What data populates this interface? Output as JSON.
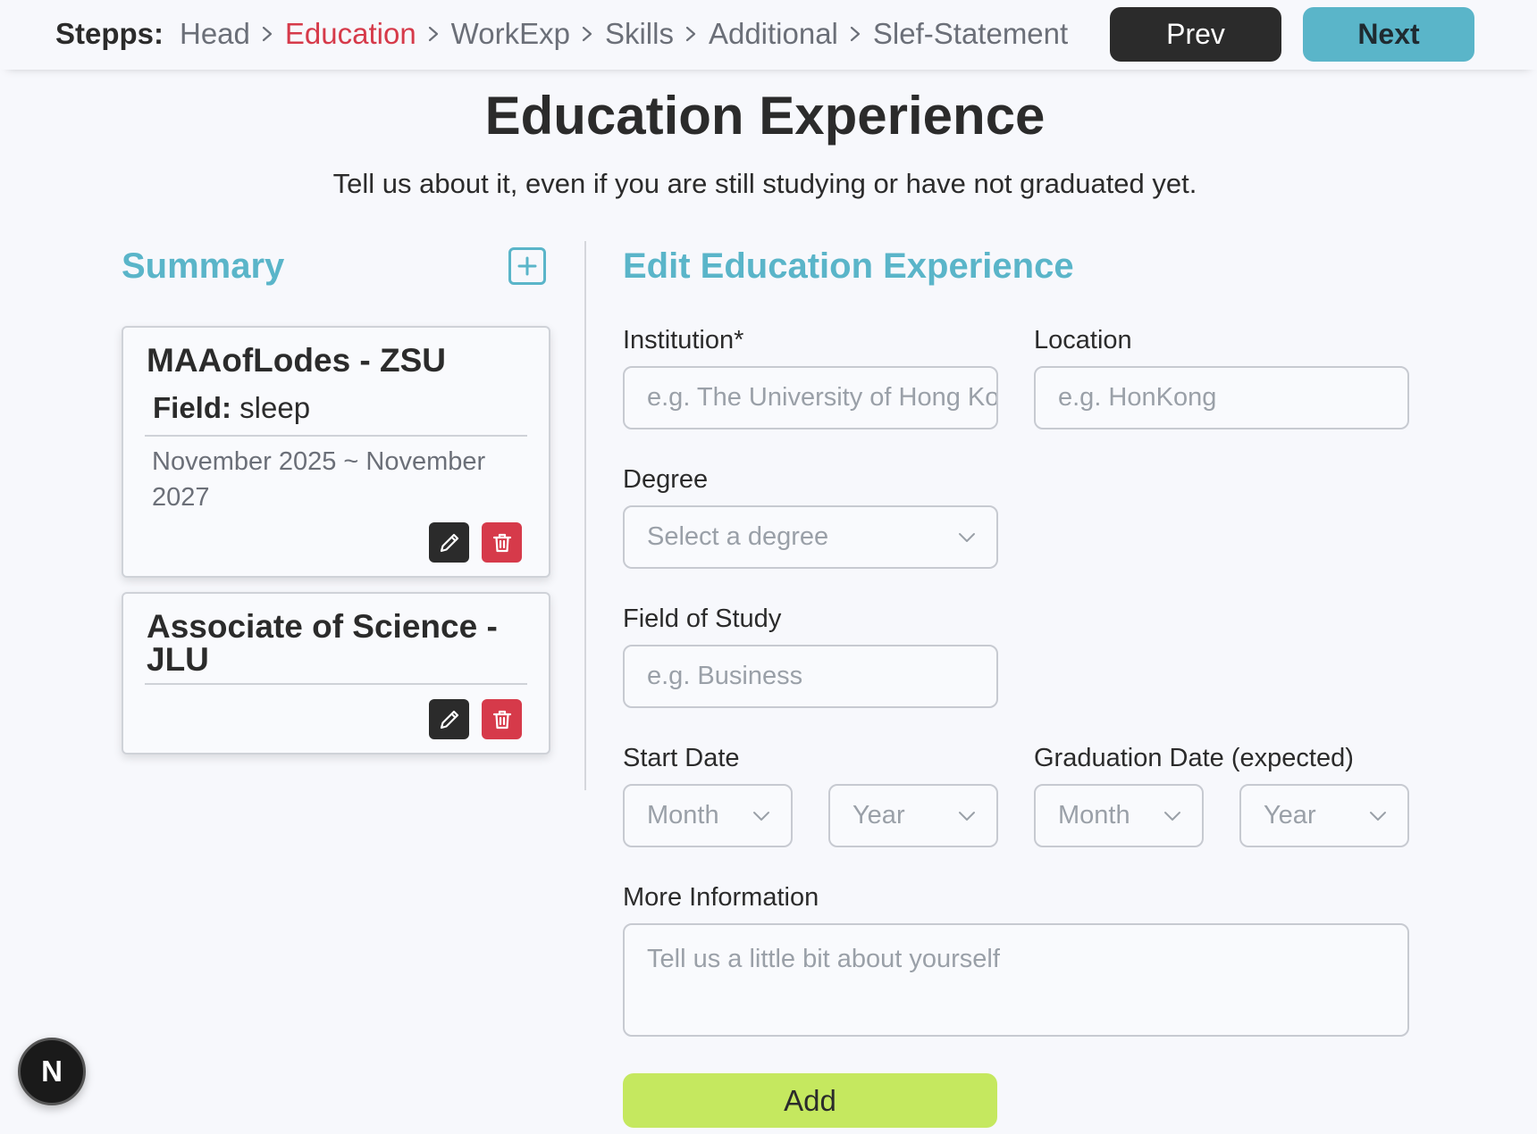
{
  "stepbar": {
    "label": "Stepps:",
    "steps": [
      {
        "label": "Head",
        "active": false
      },
      {
        "label": "Education",
        "active": true
      },
      {
        "label": "WorkExp",
        "active": false
      },
      {
        "label": "Skills",
        "active": false
      },
      {
        "label": "Additional",
        "active": false
      },
      {
        "label": "Slef-Statement",
        "active": false
      }
    ],
    "prev_label": "Prev",
    "next_label": "Next"
  },
  "header": {
    "title": "Education Experience",
    "subtitle": "Tell us about it, even if you are still studying or have not graduated yet."
  },
  "summary": {
    "title": "Summary",
    "add_icon": "plus-square-icon",
    "cards": [
      {
        "title": "MAAofLodes - ZSU",
        "field_label": "Field:",
        "field_value": "sleep",
        "dates": "November 2025 ~ November 2027"
      },
      {
        "title": "Associate of Science - JLU"
      }
    ]
  },
  "form": {
    "title": "Edit Education Experience",
    "institution": {
      "label": "Institution*",
      "placeholder": "e.g. The University of Hong Kong",
      "value": ""
    },
    "location": {
      "label": "Location",
      "placeholder": "e.g. HonKong",
      "value": ""
    },
    "degree": {
      "label": "Degree",
      "selected": "Select a degree"
    },
    "field_of_study": {
      "label": "Field of Study",
      "placeholder": "e.g. Business",
      "value": ""
    },
    "start_date": {
      "label": "Start Date",
      "month": "Month",
      "year": "Year"
    },
    "graduation_date": {
      "label": "Graduation Date (expected)",
      "month": "Month",
      "year": "Year"
    },
    "more_info": {
      "label": "More Information",
      "placeholder": "Tell us a little bit about yourself"
    },
    "add_label": "Add"
  },
  "badge": {
    "letter": "N"
  },
  "colors": {
    "accent": "#5ab5c9",
    "active_step": "#d63a4a",
    "dark_button": "#2b2b2b",
    "delete_button": "#d63a4a",
    "add_button": "#c5e85f",
    "background": "#f7f8fc"
  }
}
